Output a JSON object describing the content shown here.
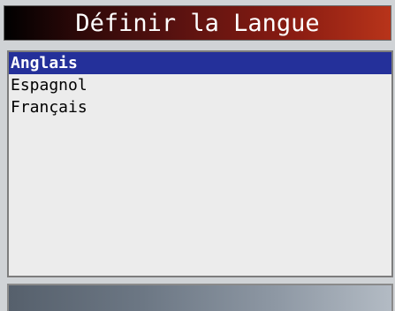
{
  "title": "Définir la Langue",
  "languages": [
    {
      "label": "Anglais",
      "selected": true
    },
    {
      "label": "Espagnol",
      "selected": false
    },
    {
      "label": "Français",
      "selected": false
    }
  ],
  "colors": {
    "title_bar_start": "#000000",
    "title_bar_end": "#b8341a",
    "selection": "#24309a",
    "list_background": "#ececec"
  }
}
